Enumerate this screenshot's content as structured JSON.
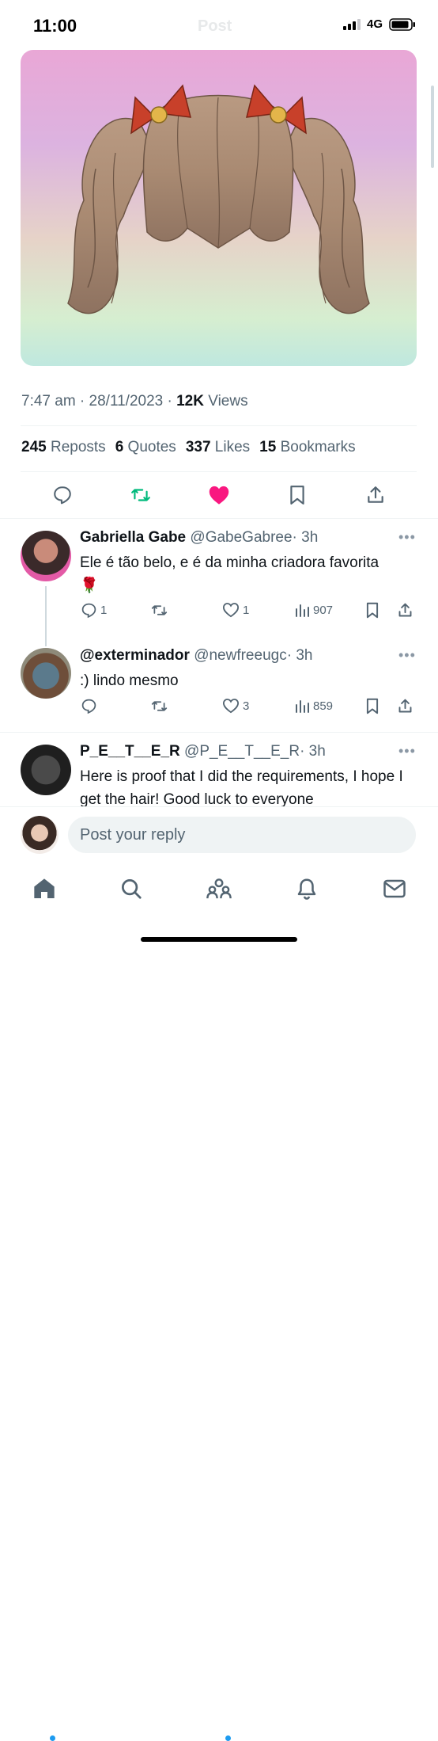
{
  "status_bar": {
    "time": "11:00",
    "network": "4G"
  },
  "header": {
    "title": "Post"
  },
  "post": {
    "timestamp": "7:47 am · 28/11/2023 · ",
    "views_count": "12K",
    "views_label": " Views",
    "stats": {
      "reposts_count": "245",
      "reposts_label": "Reposts",
      "quotes_count": "6",
      "quotes_label": "Quotes",
      "likes_count": "337",
      "likes_label": "Likes",
      "bookmarks_count": "15",
      "bookmarks_label": "Bookmarks"
    }
  },
  "replies": [
    {
      "name": "Gabriella Gabe",
      "handle": "@GabeGabree",
      "time": "· 3h",
      "text": "Ele é tão belo, e é da minha criadora favorita",
      "emoji": "🌹",
      "replies": "1",
      "reposts": "",
      "likes": "1",
      "views": "907"
    },
    {
      "name": "@exterminador",
      "handle": "@newfreeugc",
      "time": "· 3h",
      "text": ":) lindo mesmo",
      "emoji": "",
      "replies": "",
      "reposts": "",
      "likes": "3",
      "views": "859"
    },
    {
      "name": "P_E__T__E_R",
      "handle": "@P_E__T__E_R",
      "time": "· 3h",
      "text": "Here is proof that I did the requirements, I hope I get the hair! Good luck to everyone",
      "emoji": ""
    }
  ],
  "compose": {
    "placeholder": "Post your reply"
  },
  "colors": {
    "accent": "#1d9bf0",
    "like": "#f91880",
    "repost": "#00ba7c",
    "muted": "#536471"
  },
  "icons": {
    "actions": [
      "reply-icon",
      "repost-icon",
      "like-icon-filled",
      "bookmark-icon",
      "share-icon"
    ],
    "tabs": [
      "home-icon",
      "search-icon",
      "communities-icon",
      "notifications-icon",
      "messages-icon"
    ]
  }
}
